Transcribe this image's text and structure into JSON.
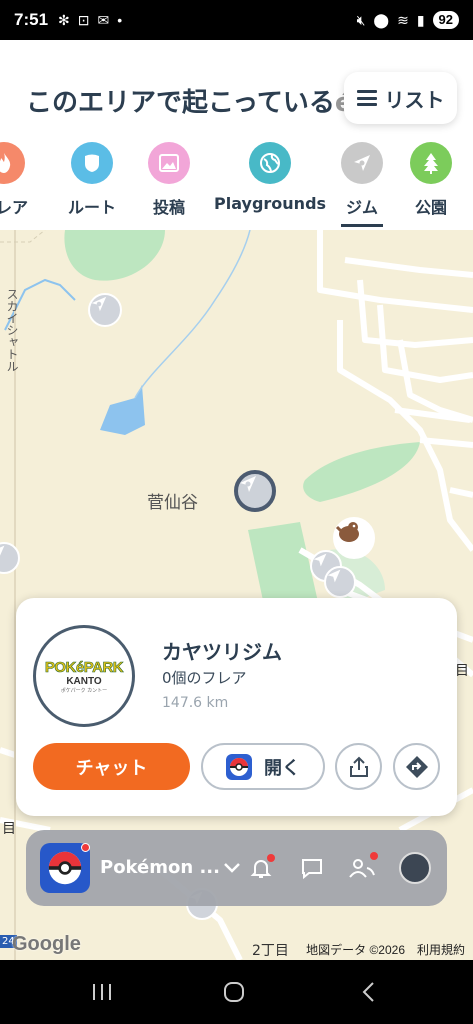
{
  "status_bar": {
    "time": "7:51",
    "battery": "92"
  },
  "header": {
    "title": "このエリアで起こっている",
    "title_suffix": "é",
    "list_button_label": "リスト"
  },
  "categories": [
    {
      "label": "フレア",
      "icon": "flame-icon",
      "color": "#f5896a"
    },
    {
      "label": "ルート",
      "icon": "shield-icon",
      "color": "#5bbde6"
    },
    {
      "label": "投稿",
      "icon": "image-icon",
      "color": "#f2a6d8"
    },
    {
      "label": "Playgrounds",
      "icon": "globe-icon",
      "color": "#48b9c7"
    },
    {
      "label": "ジム",
      "icon": "gym-icon",
      "color": "#c9c9c9",
      "selected": true
    },
    {
      "label": "公園",
      "icon": "tree-icon",
      "color": "#7ccc5b"
    }
  ],
  "map": {
    "place_label": "菅仙谷",
    "vertical_label": "スカイシャトル",
    "district_label_bottom_left": "目",
    "district_label_right": "目",
    "district_label_bottom": "2丁目",
    "route_badge": "24",
    "google_logo": "Google",
    "attribution": "地図データ ©2026　利用規約"
  },
  "gym_card": {
    "name": "カヤツリジム",
    "flares": "0個のフレア",
    "distance": "147.6 km",
    "logo_main": "POKéPARK",
    "logo_sub": "KANTO",
    "logo_small": "ポケパーク カントー",
    "chat_button": "チャット",
    "open_button": "開く"
  },
  "bottom_bar": {
    "app_name": "Pokémon ..."
  },
  "colors": {
    "accent_orange": "#f26a21",
    "text_dark": "#2c3e50",
    "map_bg": "#f3eedb",
    "park_green": "#bde6c0",
    "water_blue": "#8dc3ee"
  }
}
